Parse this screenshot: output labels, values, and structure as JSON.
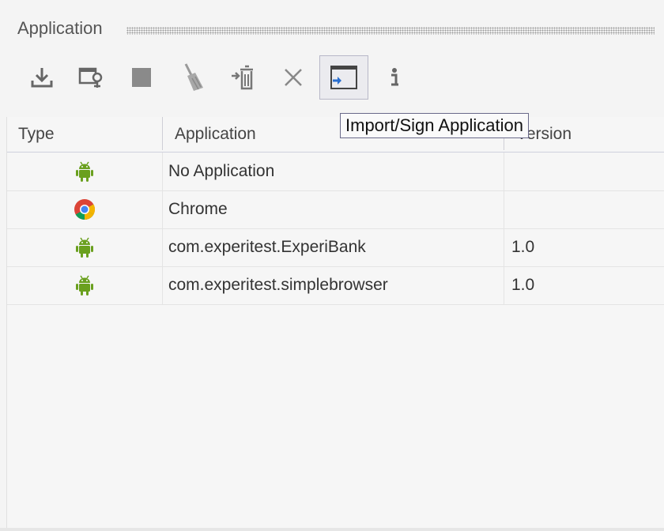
{
  "panel": {
    "title": "Application"
  },
  "toolbar": {
    "buttons": [
      {
        "name": "install-button",
        "icon": "download-icon"
      },
      {
        "name": "launch-button",
        "icon": "launch-app-icon"
      },
      {
        "name": "stop-button",
        "icon": "stop-icon"
      },
      {
        "name": "clear-data-button",
        "icon": "broom-icon"
      },
      {
        "name": "uninstall-button",
        "icon": "uninstall-icon"
      },
      {
        "name": "remove-button",
        "icon": "close-icon"
      },
      {
        "name": "import-sign-button",
        "icon": "import-window-icon",
        "active": true
      },
      {
        "name": "info-button",
        "icon": "info-icon"
      }
    ],
    "tooltip": "Import/Sign Application"
  },
  "table": {
    "columns": [
      "Type",
      "Application",
      "Version"
    ],
    "rows": [
      {
        "type_icon": "android-icon",
        "application": "No Application",
        "version": ""
      },
      {
        "type_icon": "chrome-icon",
        "application": "Chrome",
        "version": ""
      },
      {
        "type_icon": "android-icon",
        "application": "com.experitest.ExperiBank",
        "version": "1.0"
      },
      {
        "type_icon": "android-icon",
        "application": "com.experitest.simplebrowser",
        "version": "1.0"
      }
    ]
  },
  "colors": {
    "android": "#6aa01e",
    "accent": "#2a6fd0"
  }
}
